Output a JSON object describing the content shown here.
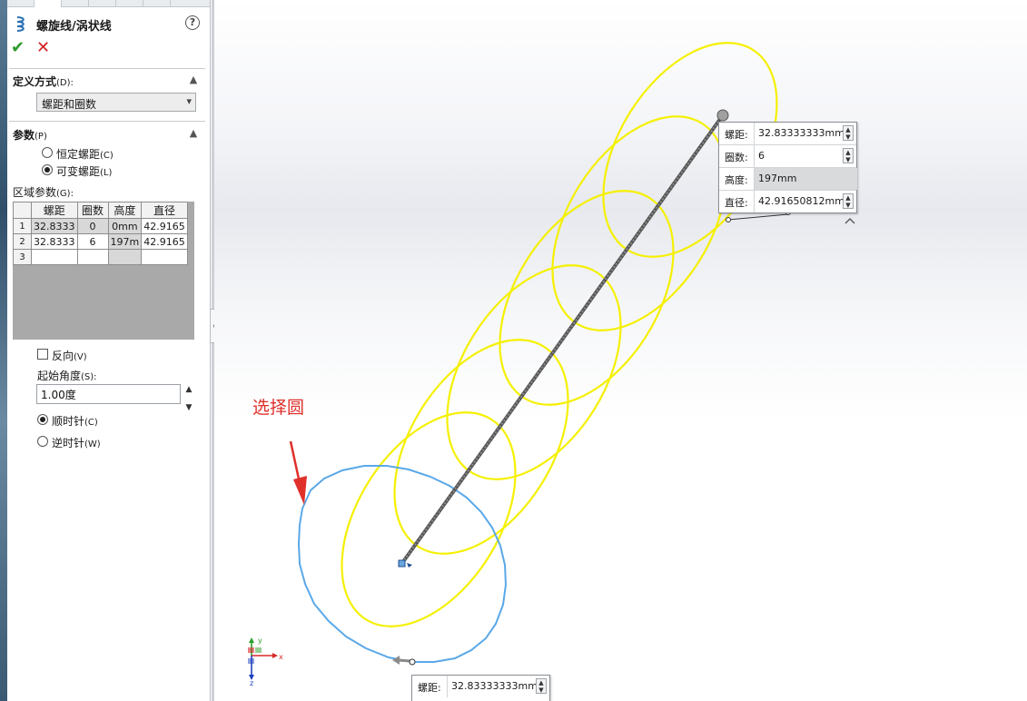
{
  "feature": {
    "title": "螺旋线/涡状线"
  },
  "definition": {
    "section_title": "定义方式",
    "section_key": "(D):",
    "selected": "螺距和圈数"
  },
  "parameters": {
    "section_title": "参数",
    "section_key": "(P)",
    "options": [
      {
        "label": "恒定螺距",
        "key": "(C)",
        "selected": false
      },
      {
        "label": "可变螺距",
        "key": "(L)",
        "selected": true
      }
    ]
  },
  "region": {
    "label": "区域参数",
    "key": "(G):",
    "columns": [
      "螺距",
      "圈数",
      "高度",
      "直径"
    ],
    "rows": [
      {
        "n": "1",
        "pitch": "32.8333",
        "turns": "0",
        "height": "0mm",
        "diameter": "42.9165"
      },
      {
        "n": "2",
        "pitch": "32.8333",
        "turns": "6",
        "height": "197m",
        "diameter": "42.9165"
      },
      {
        "n": "3",
        "pitch": "",
        "turns": "",
        "height": "",
        "diameter": ""
      }
    ]
  },
  "reverse": {
    "label": "反向",
    "key": "(V)",
    "checked": false
  },
  "start_angle": {
    "label": "起始角度",
    "key": "(S):",
    "value": "1.00度"
  },
  "direction": {
    "options": [
      {
        "label": "顺时针",
        "key": "(C)",
        "selected": true
      },
      {
        "label": "逆时针",
        "key": "(W)",
        "selected": false
      }
    ]
  },
  "callout_top": {
    "rows": [
      {
        "label": "螺距:",
        "value": "32.83333333mm"
      },
      {
        "label": "圈数:",
        "value": "6"
      },
      {
        "label": "高度:",
        "value": "197mm"
      },
      {
        "label": "直径:",
        "value": "42.91650812mm"
      }
    ]
  },
  "callout_bottom": {
    "rows": [
      {
        "label": "螺距:",
        "value": "32.83333333mm"
      }
    ]
  },
  "annotation": {
    "text": "选择圆",
    "color": "#e0302a"
  },
  "colors": {
    "helix_circles": "#f5f000",
    "selected_circle": "#5aa8e8",
    "axis_line": "#555555"
  },
  "axes": {
    "x": "x",
    "y": "y",
    "z": "z"
  }
}
